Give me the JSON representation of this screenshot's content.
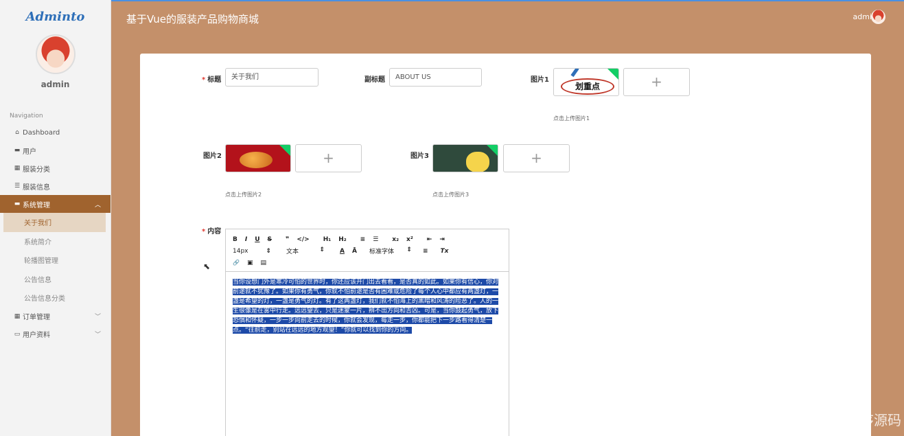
{
  "sidebar": {
    "logo": "Adminto",
    "username": "admin",
    "nav_title": "Navigation",
    "items": [
      {
        "label": "Dashboard",
        "icon": "⌂"
      },
      {
        "label": "用户",
        "icon": "▬"
      },
      {
        "label": "服装分类",
        "icon": "▦"
      },
      {
        "label": "服装信息",
        "icon": "☰"
      },
      {
        "label": "系统管理",
        "icon": "▬",
        "chevron": "︿"
      },
      {
        "label": "关于我们"
      },
      {
        "label": "系统简介"
      },
      {
        "label": "轮播图管理"
      },
      {
        "label": "公告信息"
      },
      {
        "label": "公告信息分类"
      },
      {
        "label": "订单管理",
        "icon": "▦",
        "chevron": "﹀"
      },
      {
        "label": "用户资料",
        "icon": "▭",
        "chevron": "﹀"
      }
    ]
  },
  "header": {
    "title": "基于Vue的服装产品购物商城",
    "user": "admin"
  },
  "form": {
    "title_label": "标题",
    "title_value": "关于我们",
    "subtitle_label": "副标题",
    "subtitle_value": "ABOUT US",
    "pic1_label": "图片1",
    "pic1_hint": "点击上传图片1",
    "pic1_text": "划重点",
    "pic2_label": "图片2",
    "pic2_hint": "点击上传图片2",
    "pic3_label": "图片3",
    "pic3_hint": "点击上传图片3",
    "upload_plus": "+",
    "content_label": "内容"
  },
  "editor": {
    "row1": [
      "B",
      "I",
      "U",
      "S",
      "❞",
      "</>",
      "H₁",
      "H₂",
      "≡",
      "☰",
      "x₂",
      "x²",
      "⇤",
      "⇥"
    ],
    "size": "14px",
    "header": "文本",
    "color_a": "A",
    "bg_a": "Ā",
    "font": "标准字体",
    "align": "≡",
    "clear": "Tx",
    "row3": [
      "🔗",
      "▣",
      "▤"
    ],
    "text": "当你设想门外是寒冷可怕的世界时，你还应该开门出去看看，是否真的如此。如果你有信心，你对前途就不犹豫了。如果你有勇气，你就不怕前途是否有困难或危险了每个人心中都应有两盏灯，一盏是希望的灯，一盏是勇气的灯。有了这两盏灯，我们就不怕海上的黑暗和风涛的险恶了。人的一生很像是在雾中行走。远远望去，只是迷蒙一片，辨不出方向和吉凶。可是，当你鼓起勇气，放下恐惧和怀疑，一步一步向前走去的时候，你就会发现，每走一步，你都能把下一步路看得清楚一点。“往前走，别站在远远的地方观望！”你就可以找到你的方向。"
  },
  "watermark": "CSDN @Nodejs毕设程序源码"
}
